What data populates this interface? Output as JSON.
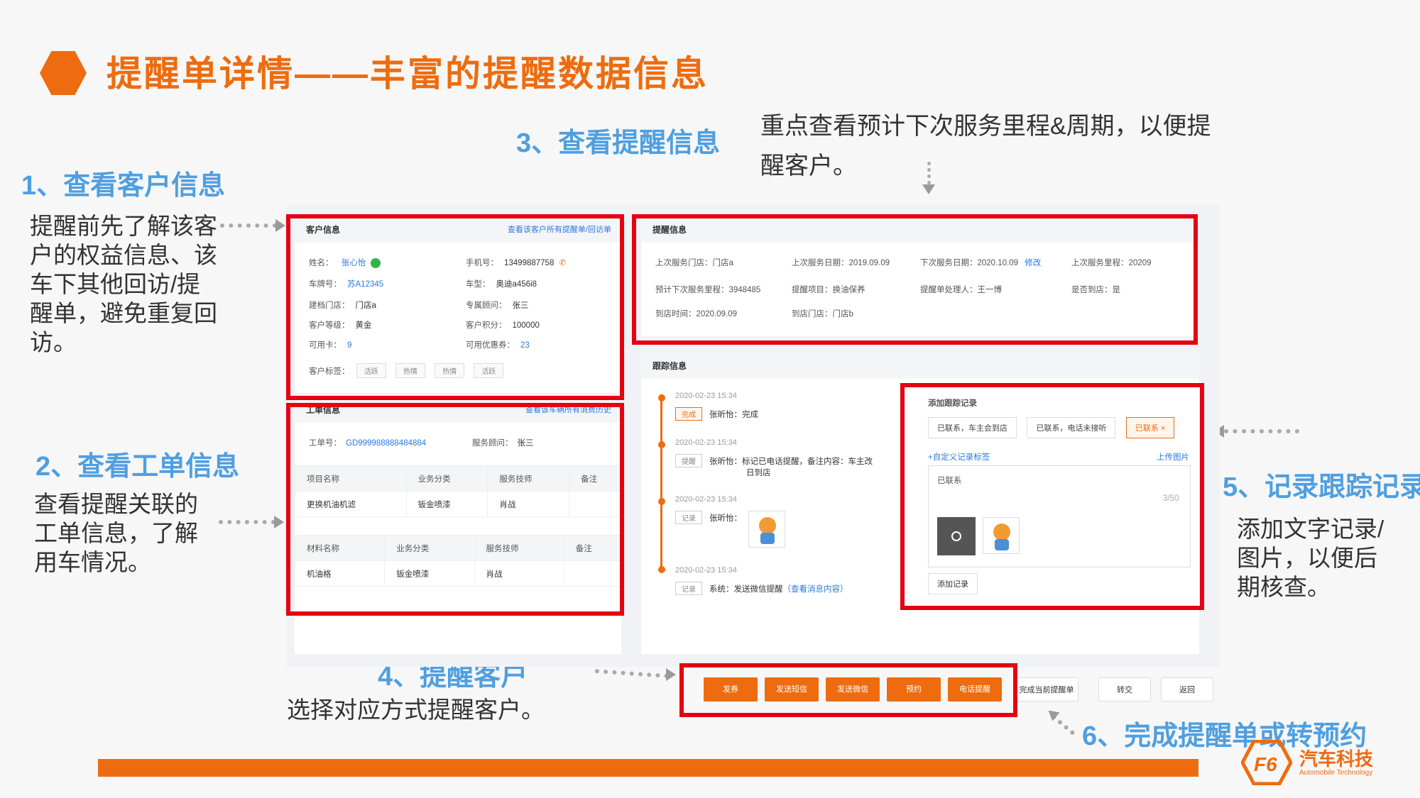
{
  "slide": {
    "title": "提醒单详情——丰富的提醒数据信息"
  },
  "callouts": {
    "c1": {
      "title": "1、查看客户信息",
      "text": "提醒前先了解该客户的权益信息、该车下其他回访/提醒单，避免重复回访。"
    },
    "c2": {
      "title": "2、查看工单信息",
      "text": "查看提醒关联的工单信息，了解用车情况。"
    },
    "c3": {
      "title": "3、查看提醒信息",
      "text": "重点查看预计下次服务里程&周期，以便提醒客户。"
    },
    "c4": {
      "title": "4、提醒客户",
      "text": "选择对应方式提醒客户。"
    },
    "c5": {
      "title": "5、记录跟踪记录",
      "text": "添加文字记录/图片，以便后期核查。"
    },
    "c6": {
      "title": "6、完成提醒单或转预约"
    }
  },
  "customer": {
    "header": "客户信息",
    "link": "查看该客户所有提醒单/回访单",
    "name_label": "姓名：",
    "name": "张心怡",
    "phone_label": "手机号：",
    "phone": "13499887758",
    "plate_label": "车牌号：",
    "plate": "苏A12345",
    "model_label": "车型：",
    "model": "奥迪a456i8",
    "store_label": "建档门店：",
    "store": "门店a",
    "advisor_label": "专属顾问：",
    "advisor": "张三",
    "level_label": "客户等级：",
    "level": "黄金",
    "points_label": "客户积分：",
    "points": "100000",
    "cards_label": "可用卡：",
    "cards": "9",
    "coupons_label": "可用优惠券：",
    "coupons": "23",
    "tags_label": "客户标签：",
    "tags": [
      "活跃",
      "热情",
      "热情",
      "活跃"
    ]
  },
  "workorder": {
    "header": "工单信息",
    "link": "查看该车辆所有消费历史",
    "no_label": "工单号：",
    "no": "GD999988888484884",
    "advisor_label": "服务顾问：",
    "advisor": "张三",
    "items_cols": [
      "项目名称",
      "业务分类",
      "服务技师",
      "备注"
    ],
    "items_row": [
      "更换机油机滤",
      "钣金喷漆",
      "肖战",
      ""
    ],
    "parts_cols": [
      "材料名称",
      "业务分类",
      "服务技师",
      "备注"
    ],
    "parts_row": [
      "机油格",
      "钣金喷漆",
      "肖战",
      ""
    ]
  },
  "reminder": {
    "header": "提醒信息",
    "last_store": "上次服务门店：门店a",
    "last_date": "上次服务日期：2019.09.09",
    "next_date": "下次服务日期：2020.10.09",
    "edit": "修改",
    "last_mileage": "上次服务里程：20209",
    "next_mileage": "预计下次服务里程：3948485",
    "item": "提醒项目：换油保养",
    "handler": "提醒单处理人：王一博",
    "arrived": "是否到店：是",
    "arrive_time": "到店时间：2020.09.09",
    "arrive_store": "到店门店：门店b"
  },
  "tracking": {
    "header": "跟踪信息",
    "entries": [
      {
        "time": "2020-02-23  15:34",
        "tag": "完成",
        "text": "张昕怡：完成"
      },
      {
        "time": "2020-02-23  15:34",
        "tag": "提醒",
        "text": "张昕怡：标记已电话提醒，备注内容：车主改",
        "text2": "日到店"
      },
      {
        "time": "2020-02-23  15:34",
        "tag": "记录",
        "text": "张昕怡："
      },
      {
        "time": "2020-02-23  15:34",
        "tag": "记录",
        "text": "系统：发送微信提醒",
        "link": "（查看消息内容）"
      }
    ]
  },
  "add_record": {
    "header": "添加跟踪记录",
    "chips": [
      "已联系，车主会到店",
      "已联系，电话未接听",
      "已联系 ×"
    ],
    "custom_tag": "+自定义记录标签",
    "upload": "上传图片",
    "text": "已联系",
    "counter": "3/50",
    "button": "添加记录"
  },
  "actions": {
    "orange": [
      "发券",
      "发送短信",
      "发送微信",
      "预约",
      "电话提醒"
    ],
    "white": [
      "完成当前提醒单",
      "转交",
      "返回"
    ]
  },
  "logo": {
    "name": "汽车科技",
    "sub": "Automobile Technology"
  },
  "colors": {
    "accent": "#ee6c0f",
    "callout": "#4f9fe0",
    "highlight": "#e60012",
    "link": "#2a78e0"
  }
}
